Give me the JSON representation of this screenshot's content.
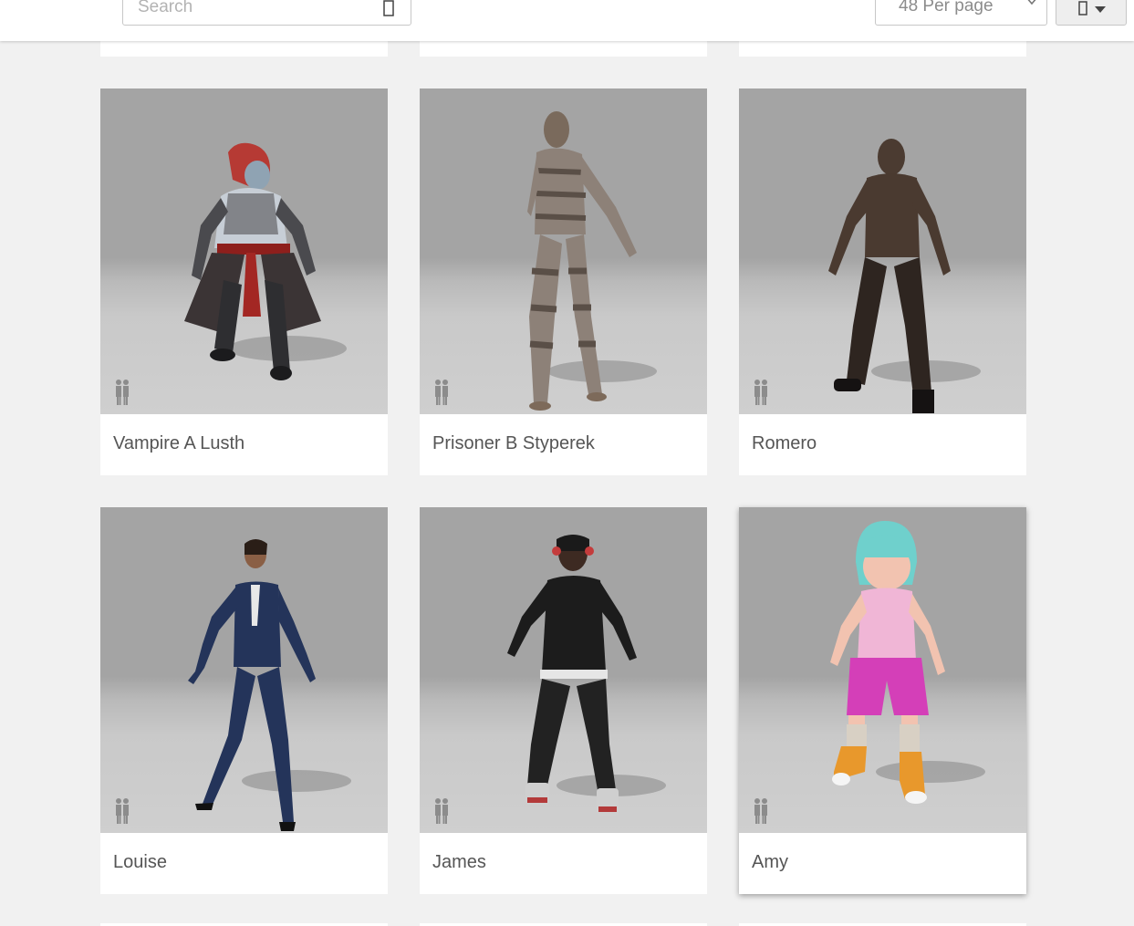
{
  "toolbar": {
    "search_placeholder": "Search",
    "search_icon": "search-icon",
    "per_page_label": "48 Per page",
    "view_icon": "grid-view-icon"
  },
  "characters": [
    {
      "name": "Vampire A Lusth",
      "icon": "character-model",
      "accent": "#b63a34"
    },
    {
      "name": "Prisoner B Styperek",
      "icon": "character-model",
      "accent": "#7d6f62"
    },
    {
      "name": "Romero",
      "icon": "character-model",
      "accent": "#4a3a30"
    },
    {
      "name": "Louise",
      "icon": "character-model",
      "accent": "#2b3a5f"
    },
    {
      "name": "James",
      "icon": "character-model",
      "accent": "#1e1e1e"
    },
    {
      "name": "Amy",
      "icon": "character-model",
      "accent": "#d43fb8"
    }
  ],
  "colors": {
    "background": "#f1f1f1",
    "card": "#ffffff",
    "title_text": "#555555"
  }
}
